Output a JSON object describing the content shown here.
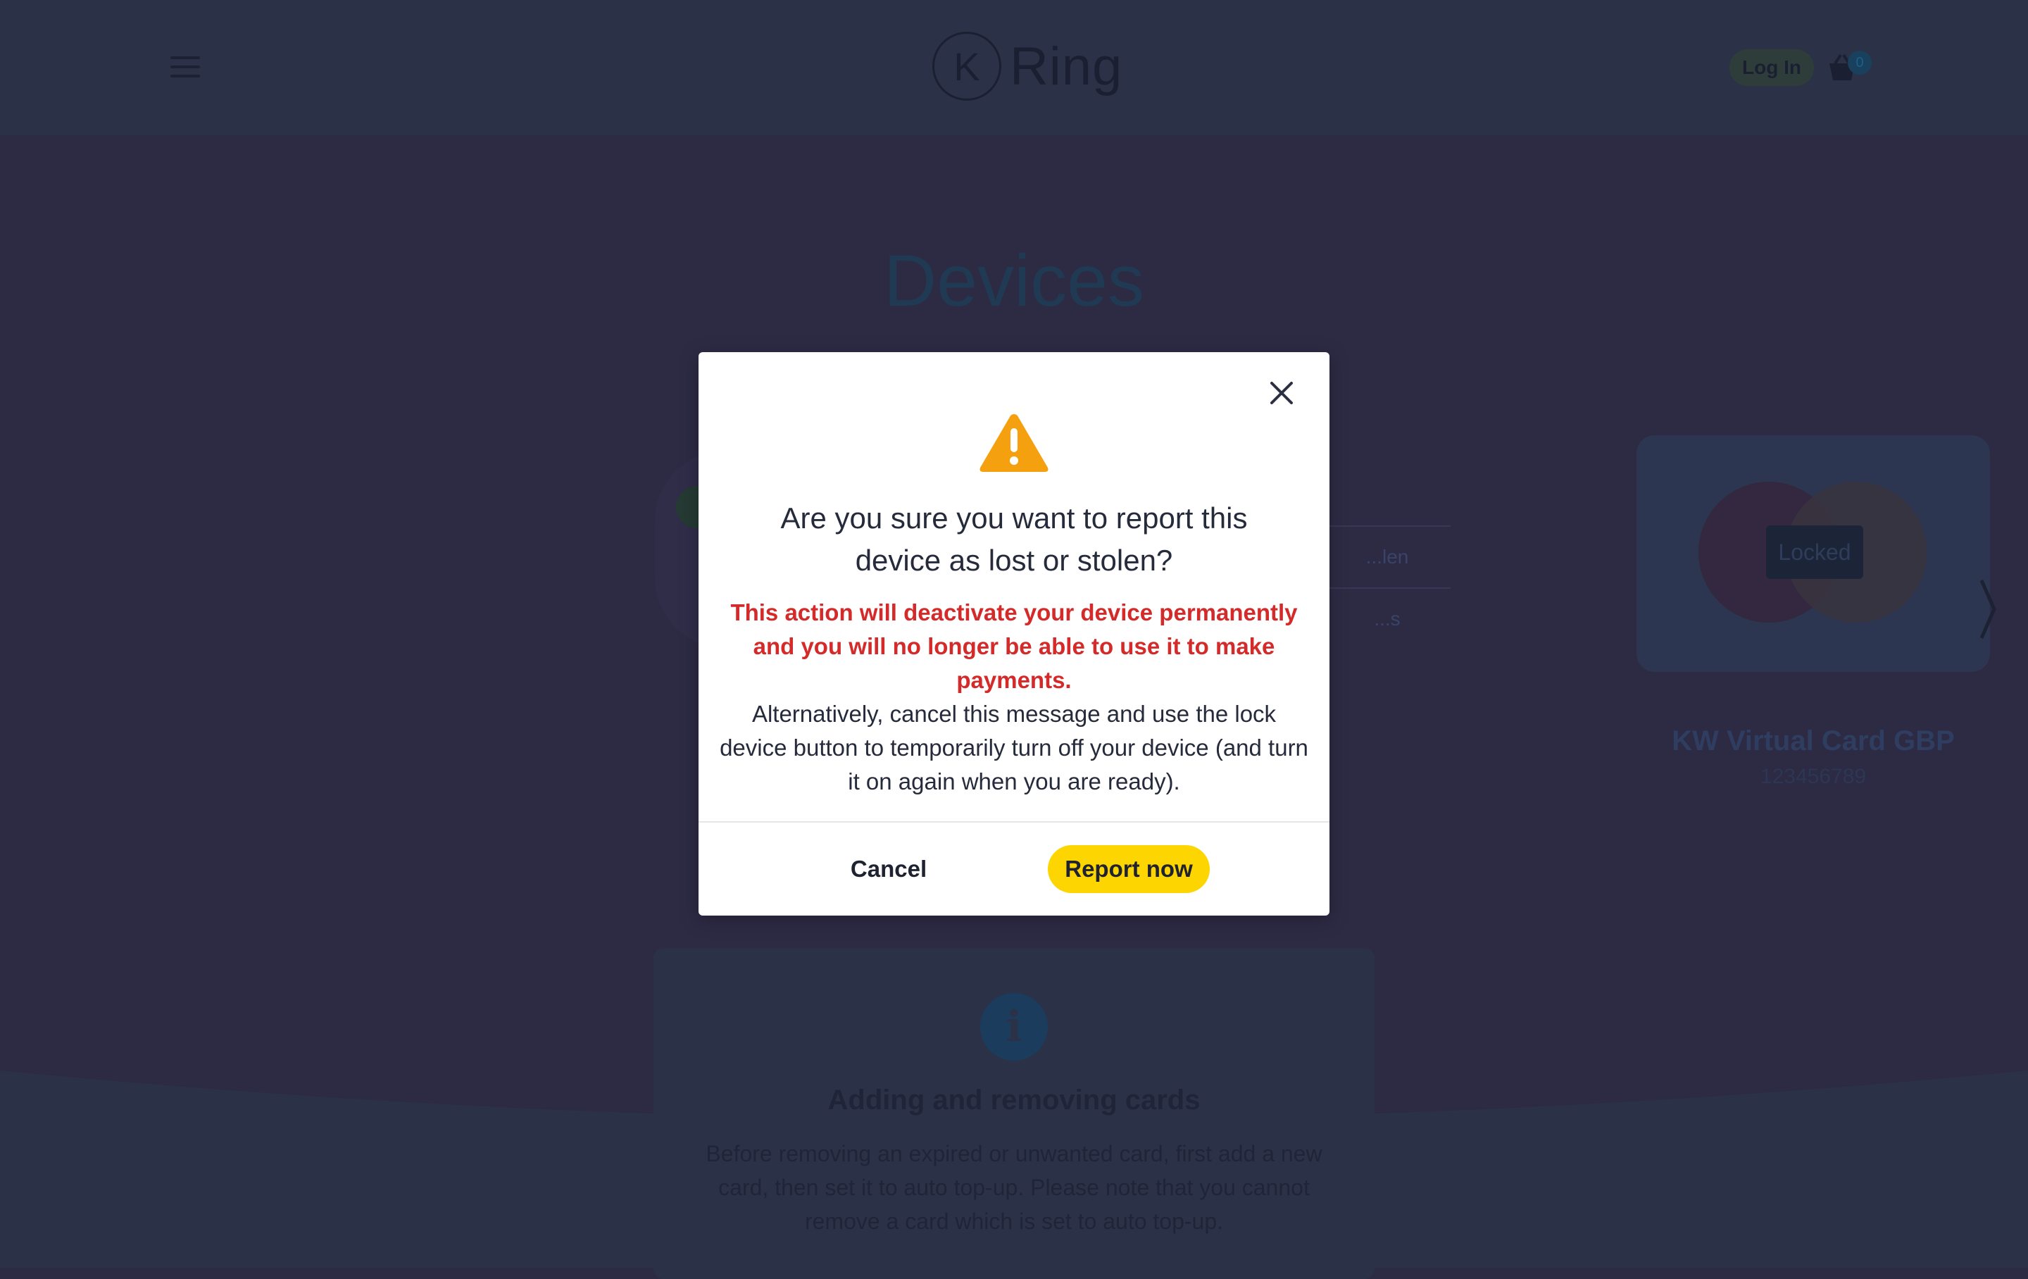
{
  "header": {
    "brand_letter": "K",
    "brand_name": "Ring",
    "login_label": "Log In",
    "basket_count": "0"
  },
  "page": {
    "title": "Devices"
  },
  "device_card": {
    "status_label": "Locked",
    "name": "KW Virtual Card GBP",
    "number": "123456789",
    "menu_items": [
      "...len",
      "...s"
    ]
  },
  "info": {
    "title": "Adding and removing cards",
    "text": "Before removing an expired or unwanted card, first add a new card, then set it to auto top-up. Please note that you cannot remove a card which is set to auto top-up."
  },
  "modal": {
    "title": "Are you sure you want to report this device as lost or stolen?",
    "warning": "This action will deactivate your device permanently and you will no longer be able to use it to make payments.",
    "body": "Alternatively, cancel this message and use the lock device button to temporarily turn off your device (and turn it on again when you are ready).",
    "cancel_label": "Cancel",
    "confirm_label": "Report now"
  },
  "colors": {
    "accent_yellow": "#fdd500",
    "warning_red": "#d42a2a",
    "warning_icon_orange": "#f5a10f",
    "overlay_navy": "#2b3248"
  },
  "icons": {
    "menu": "hamburger-icon",
    "basket": "basket-icon",
    "close": "close-icon",
    "warning": "warning-triangle-icon",
    "info": "info-icon"
  }
}
